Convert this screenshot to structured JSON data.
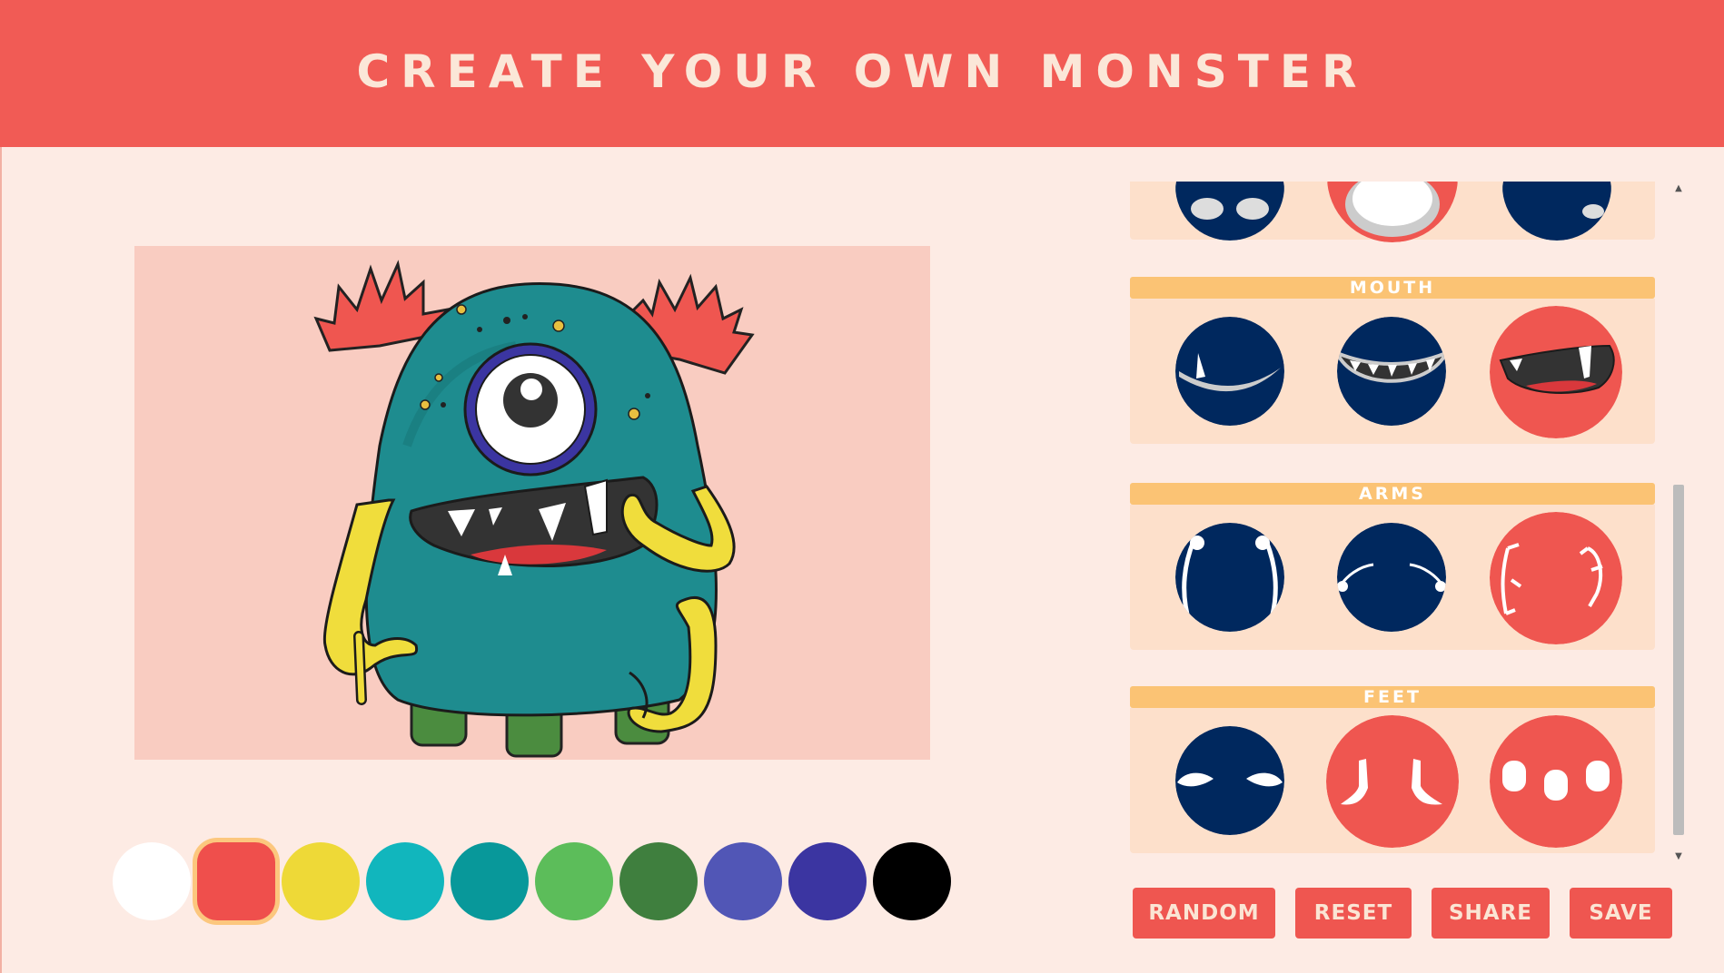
{
  "header": {
    "title": "CREATE YOUR OWN MONSTER"
  },
  "canvas": {
    "background": "#f9ccc1",
    "body_color": "#1e8c8f"
  },
  "colors": {
    "selected_index": 1,
    "palette": [
      "#ffffff",
      "#ef4f4c",
      "#eed937",
      "#11b6bd",
      "#08989a",
      "#5cbd5a",
      "#3f7f3e",
      "#5156b6",
      "#3b35a1",
      "#000000"
    ]
  },
  "sections": [
    {
      "label": "MOUTH"
    },
    {
      "label": "ARMS"
    },
    {
      "label": "FEET"
    }
  ],
  "buttons": {
    "random": "RANDOM",
    "reset": "RESET",
    "share": "SHARE",
    "save": "SAVE"
  },
  "theme": {
    "accent": "#f15b55",
    "option_default": "#00285e",
    "option_selected": "#ef5650",
    "section_head": "#fbc374"
  }
}
